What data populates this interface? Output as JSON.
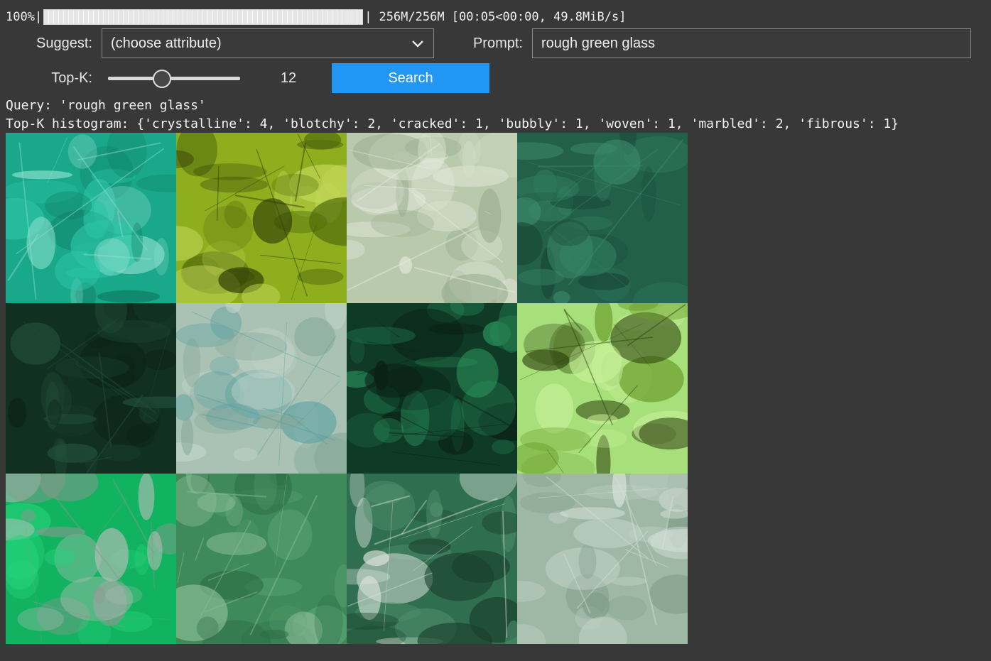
{
  "progress": {
    "percent_label": "100%",
    "fraction": 1.0,
    "left_sep": "|",
    "right_sep": "|",
    "stats": "256M/256M [00:05<00:00, 49.8MiB/s]"
  },
  "controls": {
    "suggest_label": "Suggest:",
    "suggest_value": "(choose attribute)",
    "prompt_label": "Prompt:",
    "prompt_value": "rough green glass",
    "topk_label": "Top-K:",
    "topk_value": "12",
    "topk_fraction": 0.41,
    "search_label": "Search"
  },
  "output": {
    "query_line": "Query: 'rough green glass'",
    "histogram_line": "Top-K histogram: {'crystalline': 4, 'blotchy': 2, 'cracked': 1, 'bubbly': 1, 'woven': 1, 'marbled': 2, 'fibrous': 1}"
  },
  "results": [
    {
      "name": "result-teal-crystal",
      "colors": [
        "#1aa88a",
        "#2bc4a6",
        "#0e7a62",
        "#8fe0cf"
      ]
    },
    {
      "name": "result-lime-blotchy",
      "colors": [
        "#8fae1e",
        "#c4d85a",
        "#4f6a0c",
        "#2c3a05"
      ]
    },
    {
      "name": "result-pale-marble",
      "colors": [
        "#b9c9ac",
        "#d9e2cf",
        "#97ad8f",
        "#e9ede2"
      ]
    },
    {
      "name": "result-dark-green-marble",
      "colors": [
        "#23604a",
        "#2f7a5e",
        "#174636",
        "#3c8a6c"
      ]
    },
    {
      "name": "result-dark-woven",
      "colors": [
        "#123022",
        "#1b4130",
        "#0b2017",
        "#22503b"
      ]
    },
    {
      "name": "result-cracked-glass",
      "colors": [
        "#a9c2b4",
        "#c7d8ce",
        "#86a89a",
        "#5aa0a0"
      ]
    },
    {
      "name": "result-fibrous-malachite",
      "colors": [
        "#0f3a26",
        "#1c6a44",
        "#2d9a62",
        "#0a1f15"
      ]
    },
    {
      "name": "result-bubbly-glass",
      "colors": [
        "#a7e07a",
        "#c8f09a",
        "#6a9a2a",
        "#2a3a0a"
      ]
    },
    {
      "name": "result-emerald-crystals",
      "colors": [
        "#11b360",
        "#26d37c",
        "#b5bdb8",
        "#8c9690"
      ]
    },
    {
      "name": "result-rough-green-stone",
      "colors": [
        "#3f8a5a",
        "#5aa374",
        "#2b6a44",
        "#8fbf9a"
      ]
    },
    {
      "name": "result-emerald-pebbles",
      "colors": [
        "#2f6e4e",
        "#4e8d6c",
        "#1a3f2c",
        "#dfe6df"
      ]
    },
    {
      "name": "result-pale-green-quartz",
      "colors": [
        "#9fb8a6",
        "#bfd0c4",
        "#7f9c88",
        "#d8e2da"
      ]
    }
  ]
}
